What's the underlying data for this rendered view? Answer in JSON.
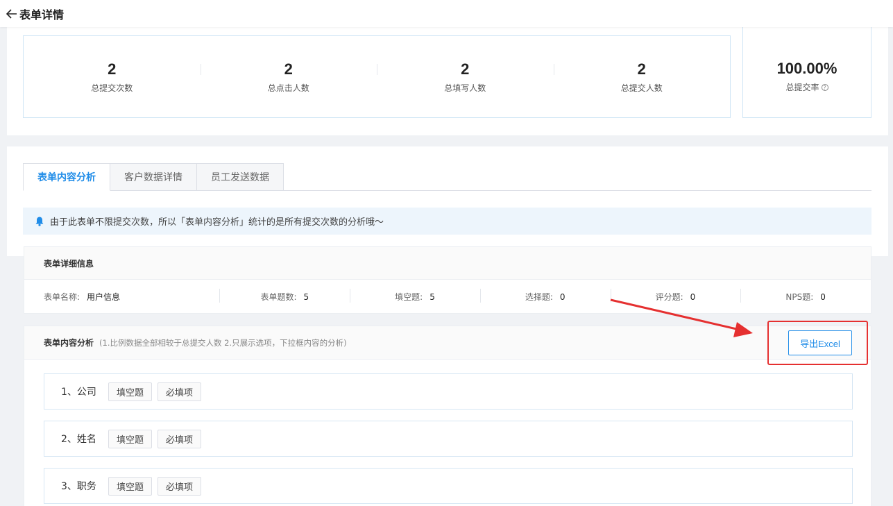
{
  "header": {
    "title": "表单详情"
  },
  "stats": [
    {
      "value": "2",
      "label": "总提交次数"
    },
    {
      "value": "2",
      "label": "总点击人数"
    },
    {
      "value": "2",
      "label": "总填写人数"
    },
    {
      "value": "2",
      "label": "总提交人数"
    }
  ],
  "rate": {
    "value": "100.00%",
    "label": "总提交率",
    "help": "?"
  },
  "tabs": [
    {
      "label": "表单内容分析",
      "active": true
    },
    {
      "label": "客户数据详情",
      "active": false
    },
    {
      "label": "员工发送数据",
      "active": false
    }
  ],
  "notice": {
    "text": "由于此表单不限提交次数，所以「表单内容分析」统计的是所有提交次数的分析哦～"
  },
  "detail": {
    "title": "表单详细信息",
    "fields": [
      {
        "label": "表单名称:",
        "value": "用户信息"
      },
      {
        "label": "表单题数:",
        "value": "5"
      },
      {
        "label": "填空题:",
        "value": "5"
      },
      {
        "label": "选择题:",
        "value": "0"
      },
      {
        "label": "评分题:",
        "value": "0"
      },
      {
        "label": "NPS题:",
        "value": "0"
      }
    ]
  },
  "analysis": {
    "title": "表单内容分析",
    "subtitle": "(1.比例数据全部相较于总提交人数 2.只展示选项，下拉框内容的分析)",
    "export_label": "导出Excel",
    "questions": [
      {
        "title": "1、公司",
        "tags": [
          "填空题",
          "必填项"
        ]
      },
      {
        "title": "2、姓名",
        "tags": [
          "填空题",
          "必填项"
        ]
      },
      {
        "title": "3、职务",
        "tags": [
          "填空题",
          "必填项"
        ]
      }
    ]
  },
  "colors": {
    "accent": "#1f8ce8",
    "annotation": "#e53030",
    "notice_bg": "#edf5fc"
  }
}
